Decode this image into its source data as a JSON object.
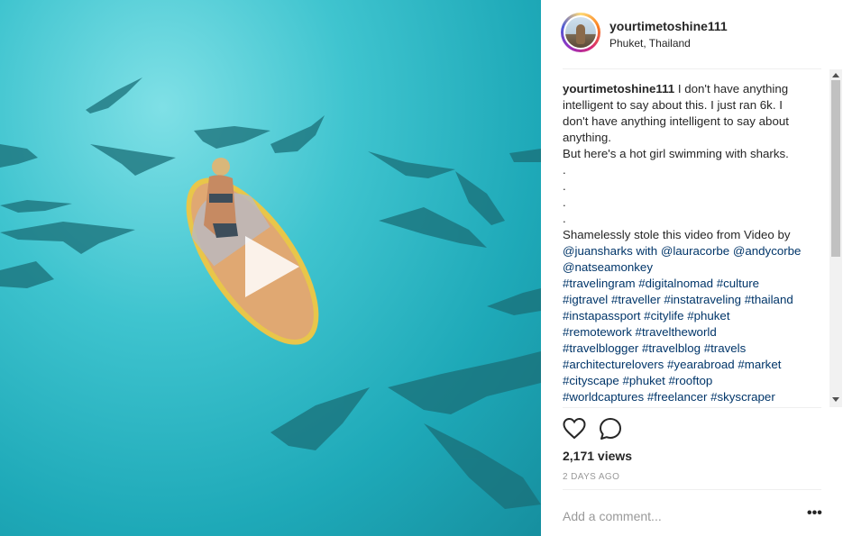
{
  "post": {
    "username": "yourtimetoshine111",
    "location": "Phuket, Thailand",
    "caption_lines": [
      "I don't have anything",
      "intelligent to say about this. I just ran 6k. I",
      "don't have anything intelligent to say about",
      "anything.",
      "But here's a hot girl swimming with sharks.",
      ".",
      ".",
      ".",
      ".",
      "Shamelessly stole this video from Video by",
      "@juansharks with @lauracorbe @andycorbe",
      "@natseamonkey",
      "#travelingram #digitalnomad #culture",
      "#igtravel #traveller #instatraveling #thailand",
      "#instapassport #citylife #phuket",
      "#remotework #traveltheworld",
      "#travelblogger #travelblog #travels",
      "#architecturelovers #yearabroad #market",
      "#cityscape #phuket #rooftop",
      "#worldcaptures #freelancer #skyscraper"
    ],
    "views": "2,171 views",
    "age": "2 DAYS AGO",
    "comment_placeholder": "Add a comment...",
    "more_label": "•••"
  },
  "icons": {
    "like": "heart-icon",
    "comment": "comment-bubble-icon",
    "play": "play-icon",
    "more": "more-options-icon"
  },
  "colors": {
    "water": "#2bb7c4",
    "text": "#262626",
    "muted": "#999999",
    "link": "#003569"
  }
}
